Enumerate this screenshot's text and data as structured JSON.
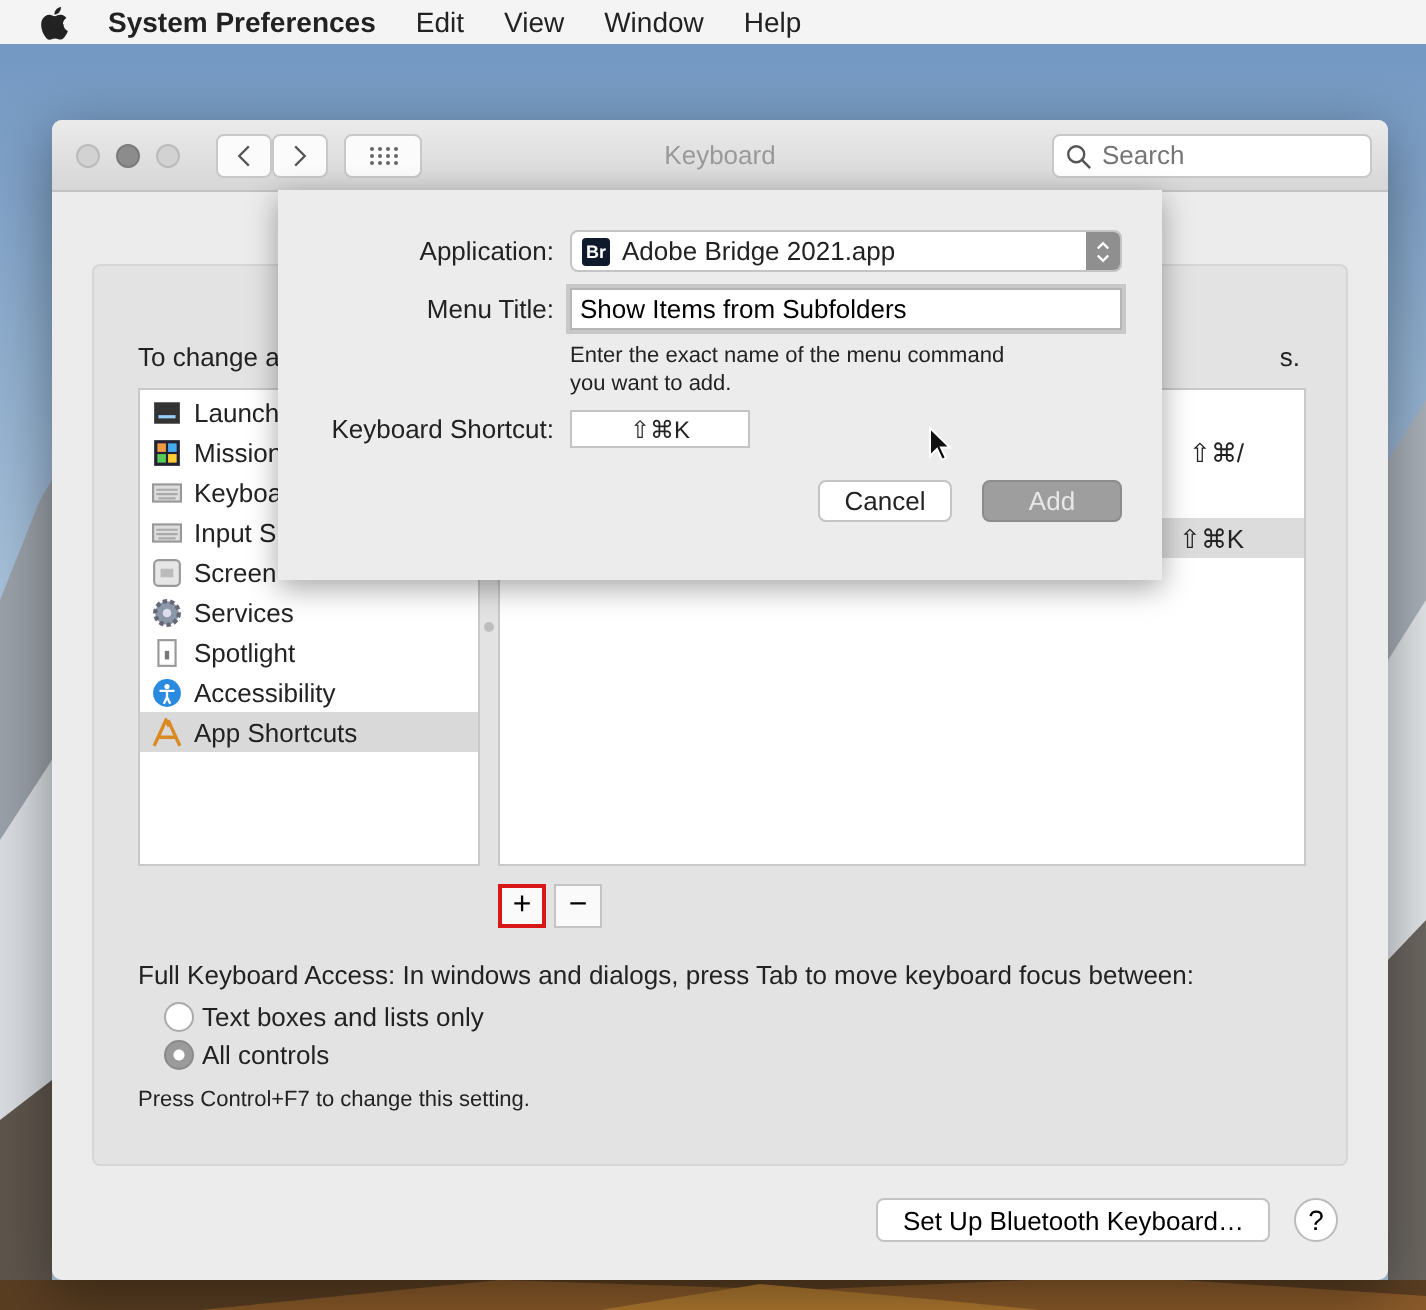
{
  "menu_bar": {
    "app_name": "System Preferences",
    "items": [
      "Edit",
      "View",
      "Window",
      "Help"
    ]
  },
  "window": {
    "title": "Keyboard",
    "search": {
      "placeholder": "Search"
    }
  },
  "instruction": {
    "start": "To change a",
    "end": "s."
  },
  "categories": [
    {
      "label": "Launch",
      "kind": "launchpad",
      "selected": false
    },
    {
      "label": "Mission",
      "kind": "mission",
      "selected": false
    },
    {
      "label": "Keyboa",
      "kind": "keyboard",
      "selected": false
    },
    {
      "label": "Input S",
      "kind": "keyboard",
      "selected": false
    },
    {
      "label": "Screen",
      "kind": "screenshot",
      "selected": false
    },
    {
      "label": "Services",
      "kind": "gear",
      "selected": false
    },
    {
      "label": "Spotlight",
      "kind": "document",
      "selected": false
    },
    {
      "label": "Accessibility",
      "kind": "accessibility",
      "selected": false
    },
    {
      "label": "App Shortcuts",
      "kind": "app",
      "selected": true
    }
  ],
  "shortcuts": [
    {
      "keys": "⇧⌘/",
      "selected": false
    },
    {
      "keys": "⇧⌘K",
      "selected": true
    }
  ],
  "add_button": {
    "label": "+",
    "highlighted": true
  },
  "remove_button": {
    "label": "−"
  },
  "keyboard_access": {
    "text": "Full Keyboard Access: In windows and dialogs, press Tab to move keyboard focus between:",
    "options": [
      {
        "label": "Text boxes and lists only",
        "selected": false
      },
      {
        "label": "All controls",
        "selected": true
      }
    ],
    "note": "Press Control+F7 to change this setting."
  },
  "bluetooth_button": "Set Up Bluetooth Keyboard…",
  "help_button": "?",
  "sheet": {
    "application_label": "Application:",
    "application": "Adobe Bridge 2021.app",
    "app_badge": "Br",
    "menu_title_label": "Menu Title:",
    "menu_title": "Show Items from Subfolders",
    "hint": "Enter the exact name of the menu command you want to add.",
    "shortcut_label": "Keyboard Shortcut:",
    "shortcut": "⇧⌘K",
    "buttons": [
      {
        "label": "Cancel",
        "disabled": false
      },
      {
        "label": "Add",
        "disabled": true
      }
    ]
  }
}
